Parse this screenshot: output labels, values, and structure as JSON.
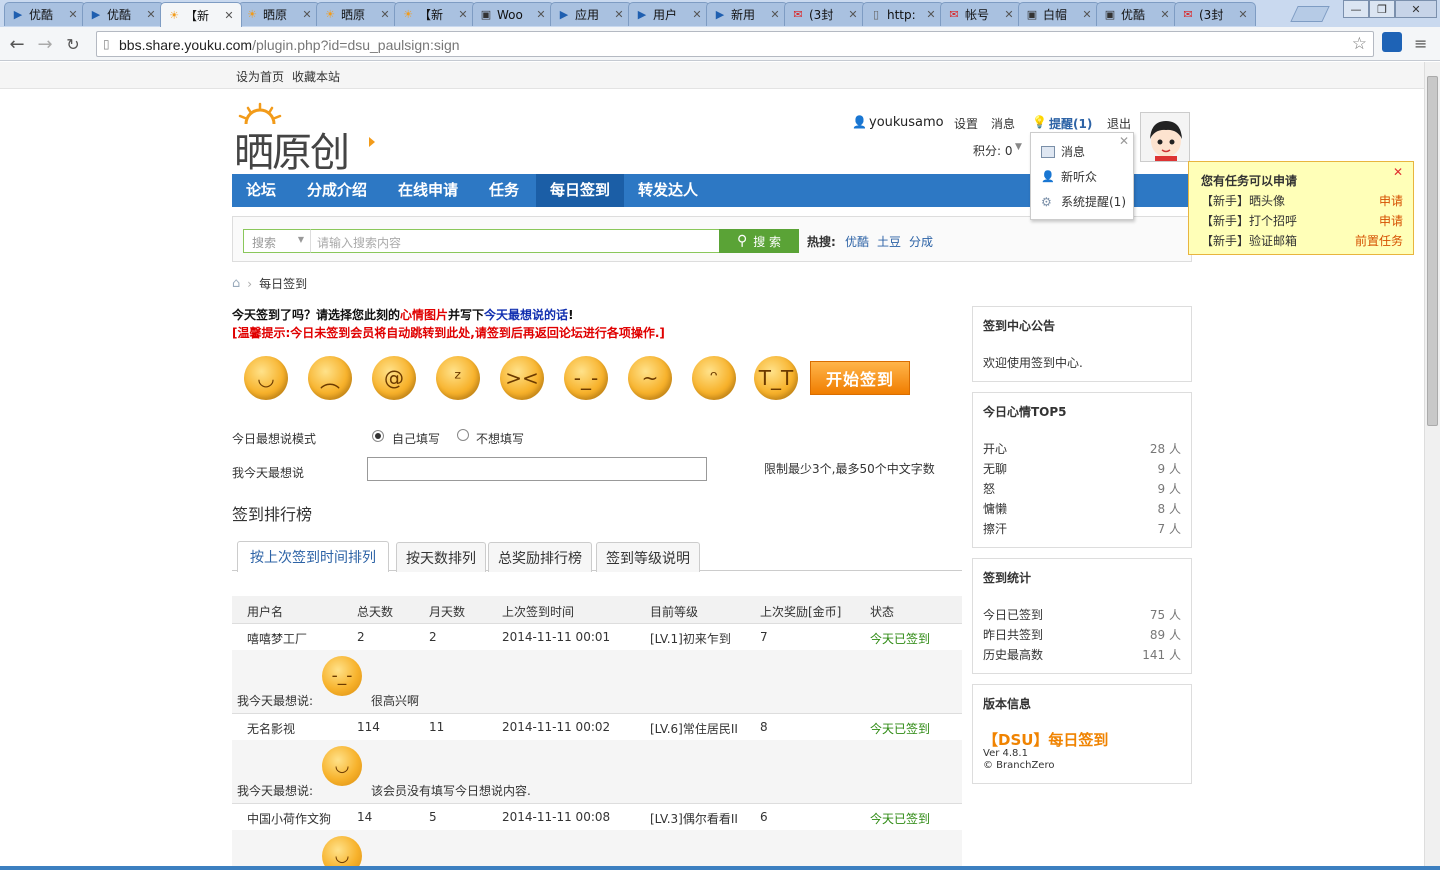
{
  "browser": {
    "tabs": [
      {
        "title": "优酷",
        "icon": "youku-icon"
      },
      {
        "title": "优酷",
        "icon": "youku-icon"
      },
      {
        "title": "【新",
        "icon": "shaiyuanchuang-icon",
        "active": true
      },
      {
        "title": "晒原",
        "icon": "shaiyuanchuang-icon"
      },
      {
        "title": "晒原",
        "icon": "shaiyuanchuang-icon"
      },
      {
        "title": "【新",
        "icon": "shaiyuanchuang-icon"
      },
      {
        "title": "Woo",
        "icon": "image-icon"
      },
      {
        "title": "应用",
        "icon": "youku-icon"
      },
      {
        "title": "用户",
        "icon": "youku-icon"
      },
      {
        "title": "新用",
        "icon": "youku-icon"
      },
      {
        "title": "(3封",
        "icon": "mail-icon"
      },
      {
        "title": "http:",
        "icon": "page-icon"
      },
      {
        "title": "帐号",
        "icon": "mail-icon"
      },
      {
        "title": "白帽",
        "icon": "image-icon"
      },
      {
        "title": "优酷",
        "icon": "image-icon"
      },
      {
        "title": "(3封",
        "icon": "mail-icon"
      }
    ],
    "url_domain": "bbs.share.youku.com",
    "url_path": "/plugin.php?id=dsu_paulsign:sign"
  },
  "topbar": {
    "set_home": "设为首页",
    "bookmark": "收藏本站"
  },
  "logo": {
    "text": "晒原创"
  },
  "user": {
    "name": "youkusamo",
    "settings": "设置",
    "messages": "消息",
    "alerts": "提醒(1)",
    "logout": "退出",
    "points": "积分: 0"
  },
  "dropdown": {
    "items": [
      "消息",
      "新听众",
      "系统提醒(1)"
    ]
  },
  "nav": {
    "items": [
      "论坛",
      "分成介绍",
      "在线申请",
      "任务",
      "每日签到",
      "转发达人"
    ],
    "active": 4
  },
  "search": {
    "select": "搜索",
    "placeholder": "请输入搜索内容",
    "button": "搜 索",
    "hot_label": "热搜:",
    "hot_links": [
      "优酷",
      "土豆",
      "分成"
    ]
  },
  "task_notice": {
    "title": "您有任务可以申请",
    "rows": [
      {
        "name": "【新手】晒头像",
        "action": "申请"
      },
      {
        "name": "【新手】打个招呼",
        "action": "申请"
      },
      {
        "name": "【新手】验证邮箱",
        "action": "前置任务"
      }
    ]
  },
  "breadcrumb": {
    "current": "每日签到"
  },
  "sign": {
    "q1_a": "今天签到了吗？请选择您此刻的",
    "q1_b": "心情图片",
    "q1_c": "并写下",
    "q1_d": "今天最想说的话",
    "q1_e": "!",
    "q2": "[温馨提示:今日未签到会员将自动跳转到此处,请签到后再返回论坛进行各项操作.]",
    "moods": [
      "开心",
      "难过",
      "郁闷",
      "无聊",
      "怒",
      "擦汗",
      "奋斗",
      "慵懒",
      "衰"
    ],
    "start_button": "开始签到",
    "mode_label": "今日最想说模式",
    "mode_options": [
      "自己填写",
      "不想填写"
    ],
    "say_label": "我今天最想说",
    "hint": "限制最少3个,最多50个中文字数"
  },
  "ranking": {
    "title": "签到排行榜",
    "tabs": [
      "按上次签到时间排列",
      "按天数排列",
      "总奖励排行榜",
      "签到等级说明"
    ],
    "headers": [
      "用户名",
      "总天数",
      "月天数",
      "上次签到时间",
      "目前等级",
      "上次奖励[金币]",
      "状态"
    ],
    "mood_label": "我今天最想说:",
    "rows": [
      {
        "user": "嘻嘻梦工厂",
        "total": "2",
        "month": "2",
        "time": "2014-11-11 00:01",
        "level": "[LV.1]初来乍到",
        "reward": "7",
        "status": "今天已签到",
        "mood": "很高兴啊"
      },
      {
        "user": "无名影视",
        "total": "114",
        "month": "11",
        "time": "2014-11-11 00:02",
        "level": "[LV.6]常住居民II",
        "reward": "8",
        "status": "今天已签到",
        "mood": "该会员没有填写今日想说内容."
      },
      {
        "user": "中国小荷作文狗",
        "total": "14",
        "month": "5",
        "time": "2014-11-11 00:08",
        "level": "[LV.3]偶尔看看II",
        "reward": "6",
        "status": "今天已签到",
        "mood": ""
      }
    ]
  },
  "sidebar": {
    "notice": {
      "title": "签到中心公告",
      "text": "欢迎使用签到中心."
    },
    "top5": {
      "title": "今日心情TOP5",
      "items": [
        {
          "name": "开心",
          "count": "28 人"
        },
        {
          "name": "无聊",
          "count": "9 人"
        },
        {
          "name": "怒",
          "count": "9 人"
        },
        {
          "name": "慵懒",
          "count": "8 人"
        },
        {
          "name": "擦汗",
          "count": "7 人"
        }
      ]
    },
    "stats": {
      "title": "签到统计",
      "items": [
        {
          "name": "今日已签到",
          "count": "75 人"
        },
        {
          "name": "昨日共签到",
          "count": "89 人"
        },
        {
          "name": "历史最高数",
          "count": "141 人"
        }
      ]
    },
    "version": {
      "title": "版本信息",
      "brand": "【DSU】每日签到",
      "ver": "Ver 4.8.1",
      "author": "© BranchZero"
    }
  },
  "colors": {
    "nav_blue": "#2d78c4",
    "nav_active": "#1b5ea6",
    "search_green": "#5aa336",
    "status_green": "#2e8a13",
    "alert_red": "#e00000",
    "notice_yellow": "#ffffb8"
  }
}
